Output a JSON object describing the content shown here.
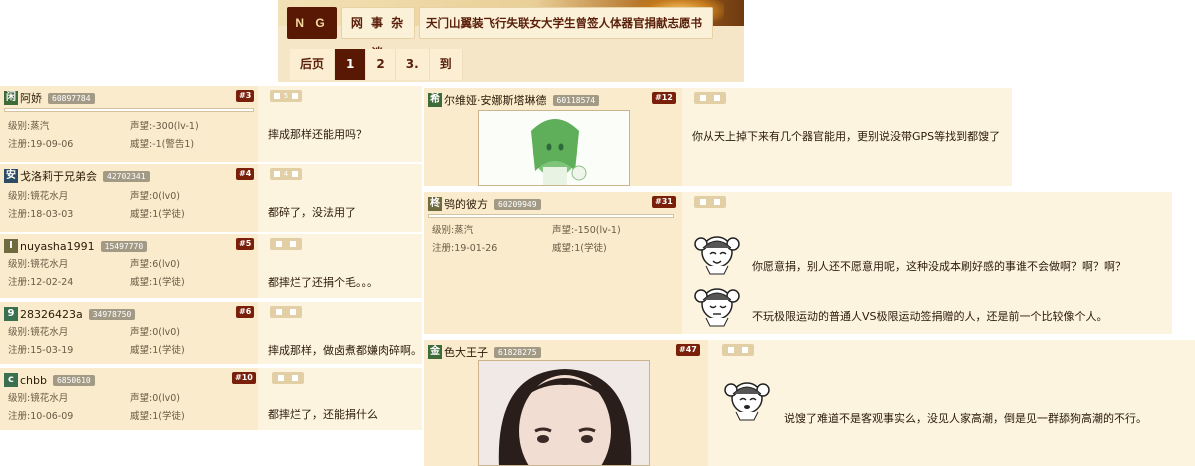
{
  "header": {
    "logo": "N G A",
    "forum": "网 事 杂 谈",
    "title": "天门山翼装飞行失联女大学生曾签人体器官捐献志愿书"
  },
  "pager": {
    "prev": "后页",
    "pages": [
      "1",
      "2",
      "3."
    ],
    "current": "1",
    "goto": "到"
  },
  "labels": {
    "level": "级别:",
    "rep": "声望:",
    "reg": "注册:",
    "prestige": "威望:"
  },
  "posts": [
    {
      "avatar": "闲",
      "name": "阿娇",
      "uid": "60897784",
      "floor": "#3",
      "likes": "5",
      "level": "蒸汽",
      "rep": "-300(lv-1)",
      "reg": "19-09-06",
      "prestige": "-1(警告1)",
      "text": "摔成那样还能用吗？"
    },
    {
      "avatar": "安",
      "name": "戈洛莉于兄弟会",
      "uid": "42702341",
      "floor": "#4",
      "likes": "4",
      "level": "镜花水月",
      "rep": "0(lv0)",
      "reg": "18-03-03",
      "prestige": "1(学徒)",
      "text": "都碎了，没法用了"
    },
    {
      "avatar": "I",
      "name": "nuyasha1991",
      "uid": "15497770",
      "floor": "#5",
      "likes": "",
      "level": "镜花水月",
      "rep": "6(lv0)",
      "reg": "12-02-24",
      "prestige": "1(学徒)",
      "text": "都摔烂了还捐个毛。。。"
    },
    {
      "avatar": "9",
      "name": "28326423a",
      "uid": "34978750",
      "floor": "#6",
      "likes": "",
      "level": "镜花水月",
      "rep": "0(lv0)",
      "reg": "15-03-19",
      "prestige": "1(学徒)",
      "text": "摔成那样，做卤煮都嫌肉碎啊。"
    },
    {
      "avatar": "c",
      "name": "chbb",
      "uid": "6850610",
      "floor": "#10",
      "likes": "",
      "level": "镜花水月",
      "rep": "0(lv0)",
      "reg": "10-06-09",
      "prestige": "1(学徒)",
      "text": "都摔烂了，还能捐什么"
    },
    {
      "avatar": "希",
      "name": "尔维娅·安娜斯塔琳德",
      "uid": "60118574",
      "floor": "#12",
      "likes": "",
      "text": "你从天上掉下来有几个器官能用，更别说没带GPS等找到都馊了"
    },
    {
      "avatar": "柊",
      "name": "鸮的彼方",
      "uid": "60209949",
      "floor": "#31",
      "likes": "",
      "level": "蒸汽",
      "rep": "-150(lv-1)",
      "reg": "19-01-26",
      "prestige": "1(学徒)",
      "text1": "你愿意捐，别人还不愿意用呢，这种没成本刷好感的事谁不会做啊？啊？啊？",
      "text2": "不玩极限运动的普通人VS极限运动签捐赠的人，还是前一个比较像个人。"
    },
    {
      "avatar": "金",
      "name": "色大王子",
      "uid": "61828275",
      "floor": "#47",
      "likes": "",
      "text": "说馊了难道不是客观事实么，没见人家高潮，倒是见一群舔狗高潮的不行。"
    }
  ]
}
